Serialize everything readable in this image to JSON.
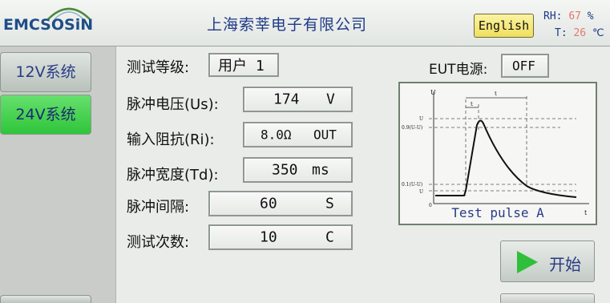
{
  "header": {
    "logo": "EMCSOSiN",
    "company": "上海索莘电子有限公司",
    "language_button": "English",
    "humidity": {
      "label": "RH:",
      "value": "67",
      "unit": "%"
    },
    "temperature": {
      "label": "T:",
      "value": "26",
      "unit": "℃"
    }
  },
  "nav": {
    "items": [
      {
        "label": "12V系统",
        "selected": false
      },
      {
        "label": "24V系统",
        "selected": true
      }
    ]
  },
  "test": {
    "level_label": "测试等级:",
    "level_value": "用户 1",
    "eut_label": "EUT电源:",
    "eut_value": "OFF",
    "voltage_label": "脉冲电压(Us):",
    "voltage_value": "174",
    "voltage_unit": "V",
    "impedance_label": "输入阻抗(Ri):",
    "impedance_value": "8.0Ω",
    "impedance_unit": "OUT",
    "width_label": "脉冲宽度(Td):",
    "width_value": "350",
    "width_unit": "ms",
    "interval_label": "脉冲间隔:",
    "interval_value": "60",
    "interval_unit": "S",
    "count_label": "测试次数:",
    "count_value": "10",
    "count_unit": "C"
  },
  "diagram": {
    "caption": "Test pulse A",
    "y_axis": "U",
    "x_axis": "t",
    "levels": [
      "Us",
      "0.9(Us-UA)",
      "0.1(Us-UA)",
      "UA"
    ],
    "zero": "0",
    "time_marks": [
      "td",
      "tr"
    ]
  },
  "actions": {
    "start_label": "开始"
  },
  "colors": {
    "accent_green": "#2fc53a",
    "text_blue": "#2a3a86",
    "env_value_red": "#e07a6e",
    "lang_yellow": "#efdf5e"
  }
}
